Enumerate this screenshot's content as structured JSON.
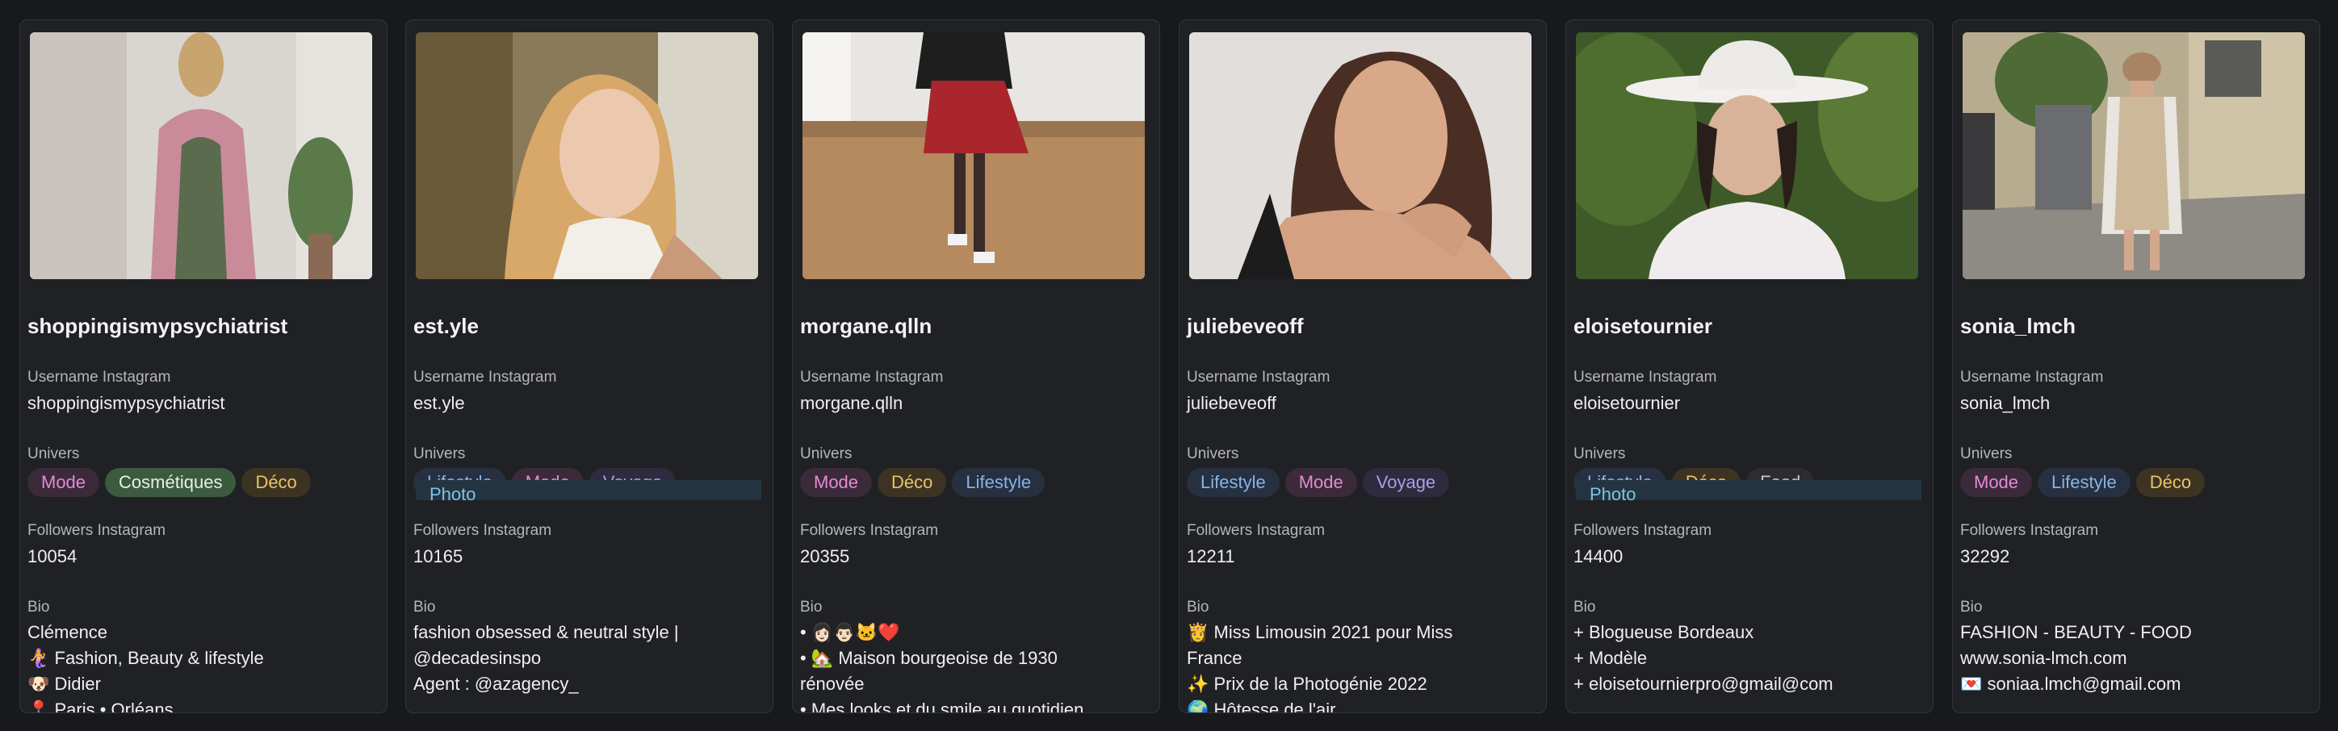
{
  "labels": {
    "username": "Username Instagram",
    "univers": "Univers",
    "followers": "Followers Instagram",
    "bio": "Bio"
  },
  "cards": [
    {
      "name": "shoppingismypsychiatrist",
      "username": "shoppingismypsychiatrist",
      "tags": [
        "Mode",
        "Cosmétiques",
        "Déco"
      ],
      "followers": "10054",
      "bio": [
        "Clémence",
        "🧜‍♀️ Fashion, Beauty & lifestyle",
        "🐶 Didier",
        "📍 Paris • Orléans..."
      ]
    },
    {
      "name": "est.yle",
      "username": "est.yle",
      "tags": [
        "Lifestyle",
        "Photo",
        "Mode",
        "Voyage"
      ],
      "followers": "10165",
      "bio": [
        "fashion obsessed & neutral style |",
        "@decadesinspo",
        "Agent : @azagency_"
      ]
    },
    {
      "name": "morgane.qlln",
      "username": "morgane.qlln",
      "tags": [
        "Mode",
        "Déco",
        "Lifestyle"
      ],
      "followers": "20355",
      "bio": [
        "• 👩🏻👨🏻🐱❤️",
        "• 🏡 Maison bourgeoise de 1930",
        "rénovée",
        "• Mes looks et du smile au quotidien ..."
      ]
    },
    {
      "name": "juliebeveoff",
      "username": "juliebeveoff",
      "tags": [
        "Lifestyle",
        "Mode",
        "Voyage"
      ],
      "followers": "12211",
      "bio": [
        "👸 Miss Limousin 2021 pour Miss",
        "France",
        "✨ Prix de la Photogénie 2022",
        "🌍 Hôtesse de l'air"
      ]
    },
    {
      "name": "eloisetournier",
      "username": "eloisetournier",
      "tags": [
        "Lifestyle",
        "Photo",
        "Déco",
        "Food"
      ],
      "followers": "14400",
      "bio": [
        "+ Blogueuse Bordeaux",
        "+ Modèle",
        "+ eloisetournierpro@gmail@com"
      ]
    },
    {
      "name": "sonia_lmch",
      "username": "sonia_lmch",
      "tags": [
        "Mode",
        "Lifestyle",
        "Déco"
      ],
      "followers": "32292",
      "bio": [
        "FASHION - BEAUTY - FOOD",
        "www.sonia-lmch.com",
        "💌 soniaa.lmch@gmail.com"
      ]
    }
  ],
  "tag_colors": {
    "Mode": "#e48ad4",
    "Cosmétiques": "#e4f2e2",
    "Déco": "#e9c46a",
    "Lifestyle": "#86b4e6",
    "Photo": "#7cc4e8",
    "Voyage": "#a8a0e6",
    "Food": "#c8c8ca"
  }
}
